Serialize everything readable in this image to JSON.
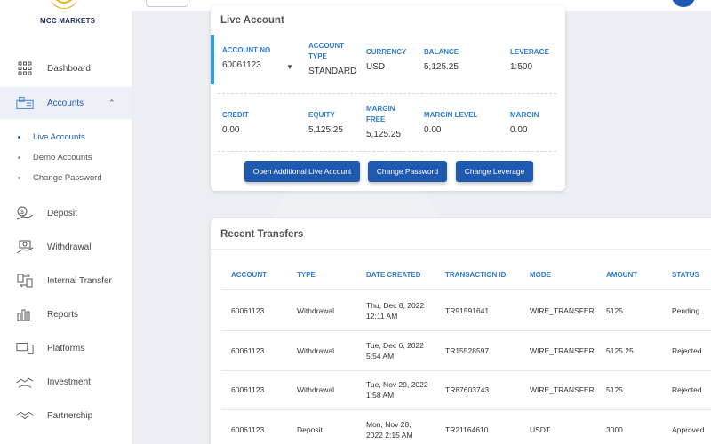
{
  "brand": {
    "name": "MCC MARKETS",
    "gold": "#e8b21a",
    "navy": "#1d2b5a"
  },
  "colors": {
    "accent": "#1f59b0",
    "header_text": "#2c7cd4",
    "live_bar": "#2c9be0"
  },
  "sidebar": {
    "items": [
      {
        "label": "Dashboard",
        "icon": "dashboard-grid-icon"
      },
      {
        "label": "Accounts",
        "icon": "accounts-icon"
      },
      {
        "label": "Deposit",
        "icon": "deposit-icon"
      },
      {
        "label": "Withdrawal",
        "icon": "withdrawal-icon"
      },
      {
        "label": "Internal Transfer",
        "icon": "transfer-icon"
      },
      {
        "label": "Reports",
        "icon": "reports-icon"
      },
      {
        "label": "Platforms",
        "icon": "platforms-icon"
      },
      {
        "label": "Investment",
        "icon": "investment-icon"
      },
      {
        "label": "Partnership",
        "icon": "partnership-icon"
      }
    ],
    "sub_items": [
      {
        "label": "Live Accounts"
      },
      {
        "label": "Demo Accounts"
      },
      {
        "label": "Change Password"
      }
    ]
  },
  "live_account": {
    "title": "Live Account",
    "account_no": {
      "label": "ACCOUNT NO",
      "value": "60061123"
    },
    "account_type": {
      "label": "ACCOUNT TYPE",
      "value": "STANDARD"
    },
    "currency": {
      "label": "CURRENCY",
      "value": "USD"
    },
    "balance": {
      "label": "BALANCE",
      "value": "5,125.25"
    },
    "leverage": {
      "label": "LEVERAGE",
      "value": "1:500"
    },
    "credit": {
      "label": "CREDIT",
      "value": "0.00"
    },
    "equity": {
      "label": "EQUITY",
      "value": "5,125.25"
    },
    "margin_free": {
      "label": "MARGIN FREE",
      "value": "5,125.25"
    },
    "margin_level": {
      "label": "MARGIN LEVEL",
      "value": "0.00"
    },
    "margin": {
      "label": "MARGIN",
      "value": "0.00"
    },
    "buttons": {
      "open_additional": "Open Additional Live Account",
      "change_password": "Change Password",
      "change_leverage": "Change Leverage"
    }
  },
  "recent_transfers": {
    "title": "Recent Transfers",
    "columns": [
      "ACCOUNT",
      "TYPE",
      "DATE CREATED",
      "TRANSACTION ID",
      "MODE",
      "AMOUNT",
      "STATUS"
    ],
    "rows": [
      {
        "account": "60061123",
        "type": "Withdrawal",
        "date1": "Thu, Dec 8, 2022",
        "date2": "12:11 AM",
        "txn": "TR91591641",
        "mode": "WIRE_TRANSFER",
        "amount": "5125",
        "status": "Pending"
      },
      {
        "account": "60061123",
        "type": "Withdrawal",
        "date1": "Tue, Dec 6, 2022",
        "date2": "5:54 AM",
        "txn": "TR15528597",
        "mode": "WIRE_TRANSFER",
        "amount": "5125.25",
        "status": "Rejected"
      },
      {
        "account": "60061123",
        "type": "Withdrawal",
        "date1": "Tue, Nov 29, 2022",
        "date2": "1:58 AM",
        "txn": "TR87603743",
        "mode": "WIRE_TRANSFER",
        "amount": "5125",
        "status": "Rejected"
      },
      {
        "account": "60061123",
        "type": "Deposit",
        "date1": "Mon, Nov 28,",
        "date2": "2022 2:15 AM",
        "txn": "TR21164610",
        "mode": "USDT",
        "amount": "3000",
        "status": "Approved"
      }
    ]
  }
}
